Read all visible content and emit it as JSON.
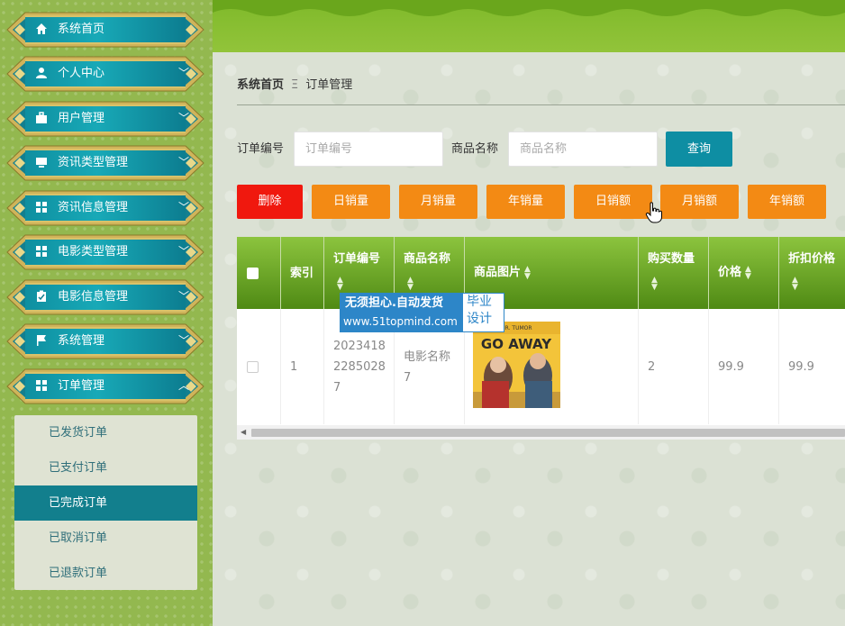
{
  "sidebar": {
    "items": [
      {
        "label": "系统首页",
        "icon": "home-icon",
        "has_chevron": false
      },
      {
        "label": "个人中心",
        "icon": "user-icon",
        "has_chevron": true
      },
      {
        "label": "用户管理",
        "icon": "briefcase-icon",
        "has_chevron": true
      },
      {
        "label": "资讯类型管理",
        "icon": "monitor-icon",
        "has_chevron": true
      },
      {
        "label": "资讯信息管理",
        "icon": "grid-icon",
        "has_chevron": true
      },
      {
        "label": "电影类型管理",
        "icon": "grid-icon",
        "has_chevron": true
      },
      {
        "label": "电影信息管理",
        "icon": "clipboard-icon",
        "has_chevron": true
      },
      {
        "label": "系统管理",
        "icon": "flag-icon",
        "has_chevron": true
      },
      {
        "label": "订单管理",
        "icon": "grid-icon",
        "has_chevron": true,
        "expanded": true
      }
    ],
    "submenu": [
      {
        "label": "已发货订单",
        "active": false
      },
      {
        "label": "已支付订单",
        "active": false
      },
      {
        "label": "已完成订单",
        "active": true
      },
      {
        "label": "已取消订单",
        "active": false
      },
      {
        "label": "已退款订单",
        "active": false
      }
    ]
  },
  "breadcrumb": {
    "home": "系统首页",
    "separator": "Ξ",
    "current": "订单管理"
  },
  "search": {
    "order_no_label": "订单编号",
    "order_no_placeholder": "订单编号",
    "product_label": "商品名称",
    "product_placeholder": "商品名称",
    "query_button": "查询"
  },
  "actions": {
    "delete": "删除",
    "daily_sales_qty": "日销量",
    "monthly_sales_qty": "月销量",
    "yearly_sales_qty": "年销量",
    "daily_sales_amt": "日销额",
    "monthly_sales_amt": "月销额",
    "yearly_sales_amt": "年销额"
  },
  "table": {
    "headers": {
      "index": "索引",
      "order_no": "订单编号",
      "product_name": "商品名称",
      "product_image": "商品图片",
      "quantity": "购买数量",
      "price": "价格",
      "discount_price": "折扣价格"
    },
    "rows": [
      {
        "index": "1",
        "order_no_1": "2023418",
        "order_no_2": "2285028",
        "order_no_3": "7",
        "product_name_1": "电影名称",
        "product_name_2": "7",
        "poster_title": "GO AWAY",
        "poster_sub": "MR. TUMOR",
        "quantity": "2",
        "price": "99.9",
        "discount_price": "99.9"
      }
    ]
  },
  "watermark": {
    "line1": "无须担心.自动发货",
    "line2": "www.51topmind.com",
    "right1": "毕业",
    "right2": "设计"
  },
  "colors": {
    "teal": "#127f8d",
    "orange": "#f38a14",
    "red": "#f0180e",
    "green_header": "#4f8a14"
  }
}
